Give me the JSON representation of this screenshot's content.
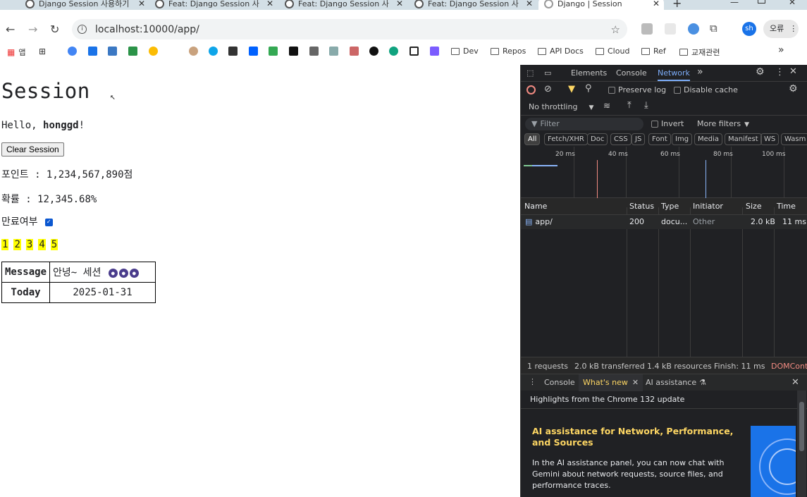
{
  "browser": {
    "tabs": [
      {
        "title": "Django Session 사용하기"
      },
      {
        "title": "Feat: Django Session 사"
      },
      {
        "title": "Feat: Django Session 사"
      },
      {
        "title": "Feat: Django Session 사"
      },
      {
        "title": "Django | Session"
      }
    ],
    "new_tab": "+",
    "url": "localhost:10000/app/",
    "profile_label": "오류",
    "avatar_label": "sh",
    "bookmarks": {
      "apps": "앱",
      "folders": [
        "Dev",
        "Repos",
        "API Docs",
        "Cloud",
        "Ref",
        "교재관련"
      ],
      "more": "»"
    }
  },
  "page": {
    "title": "Session",
    "greeting_prefix": "Hello, ",
    "greeting_user": "honggd",
    "greeting_suffix": "!",
    "clear_button": "Clear Session",
    "points": "포인트 : 1,234,567,890점",
    "rate": "확률 : 12,345.68%",
    "expired_label": "만료여부",
    "numbers": [
      "1",
      "2",
      "3",
      "4",
      "5"
    ],
    "table": {
      "rows": [
        {
          "label": "Message",
          "value": "안녕~ 세션"
        },
        {
          "label": "Today",
          "value": "2025-01-31"
        }
      ]
    }
  },
  "devtools": {
    "tabs": [
      "Elements",
      "Console",
      "Network"
    ],
    "preserve_log": "Preserve log",
    "disable_cache": "Disable cache",
    "throttling": "No throttling",
    "filter_placeholder": "Filter",
    "invert": "Invert",
    "more_filters": "More filters",
    "type_filters": [
      "All",
      "Fetch/XHR",
      "Doc",
      "CSS",
      "JS",
      "Font",
      "Img",
      "Media",
      "Manifest",
      "WS",
      "Wasm"
    ],
    "timeline_ticks": [
      "20 ms",
      "40 ms",
      "60 ms",
      "80 ms",
      "100 ms"
    ],
    "columns": [
      "Name",
      "Status",
      "Type",
      "Initiator",
      "Size",
      "Time"
    ],
    "request": {
      "name": "app/",
      "status": "200",
      "type": "docu...",
      "initiator": "Other",
      "size": "2.0 kB",
      "time": "11 ms"
    },
    "status_bar": {
      "requests": "1 requests",
      "transferred": "2.0 kB transferred",
      "resources": "1.4 kB resources",
      "finish": "Finish: 11 ms",
      "dcl": "DOMCont"
    },
    "drawer": {
      "tabs": [
        "Console",
        "What's new",
        "AI assistance"
      ],
      "headline": "Highlights from the Chrome 132 update",
      "feature_title": "AI assistance for Network, Performance, and Sources",
      "feature_body": "In the AI assistance panel, you can now chat with Gemini about network requests, source files, and performance traces."
    }
  }
}
